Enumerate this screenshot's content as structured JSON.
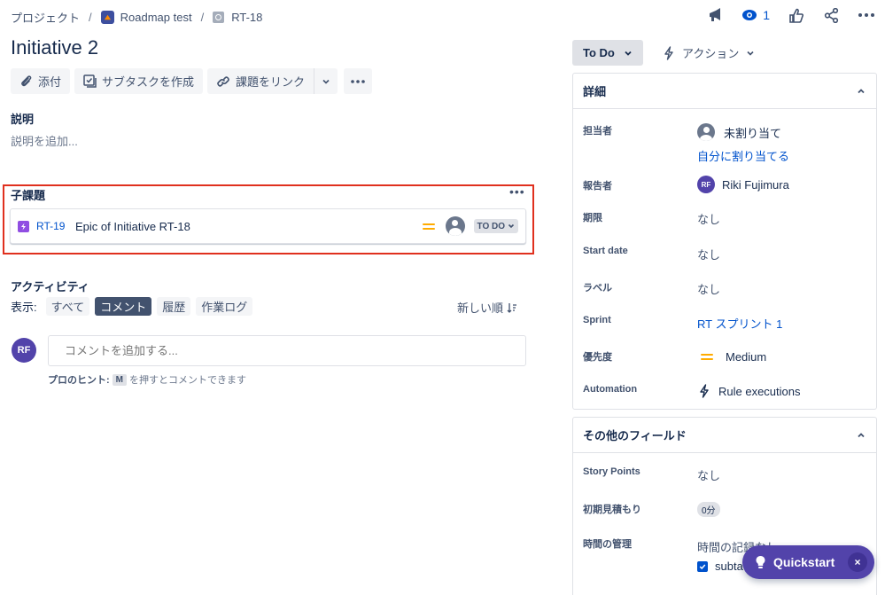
{
  "breadcrumb": {
    "project_root": "プロジェクト",
    "sep1": "/",
    "project": "Roadmap test",
    "sep2": "/",
    "issue_key": "RT-18"
  },
  "top_actions": {
    "watch_count": "1",
    "icons": [
      "megaphone-icon",
      "eye-icon",
      "thumbs-up-icon",
      "share-icon",
      "more-icon"
    ]
  },
  "issue": {
    "title": "Initiative 2"
  },
  "toolbar": {
    "attach": "添付",
    "create_subtask": "サブタスクを作成",
    "link_issue": "課題をリンク"
  },
  "description": {
    "label": "説明",
    "placeholder": "説明を追加..."
  },
  "child_issues": {
    "label": "子課題",
    "more": "•••",
    "items": [
      {
        "key": "RT-19",
        "summary": "Epic of Initiative RT-18",
        "status": "TO DO"
      }
    ]
  },
  "activity": {
    "title": "アクティビティ",
    "show_label": "表示:",
    "filters": [
      "すべて",
      "コメント",
      "履歴",
      "作業ログ"
    ],
    "active_filter": "コメント",
    "sort": "新しい順",
    "comment_avatar": "RF",
    "comment_placeholder": "コメントを追加する...",
    "pro_tip_bold": "プロのヒント:",
    "pro_tip_key": "M",
    "pro_tip_text": "を押すとコメントできます"
  },
  "status_button": "To Do",
  "action_button": "アクション",
  "details": {
    "header": "詳細",
    "assignee_label": "担当者",
    "assignee_value": "未割り当て",
    "assign_to_me": "自分に割り当てる",
    "reporter_label": "報告者",
    "reporter_avatar": "RF",
    "reporter_value": "Riki Fujimura",
    "due_label": "期限",
    "due_value": "なし",
    "start_label": "Start date",
    "start_value": "なし",
    "labels_label": "ラベル",
    "labels_value": "なし",
    "sprint_label": "Sprint",
    "sprint_value": "RT スプリント 1",
    "priority_label": "優先度",
    "priority_value": "Medium",
    "automation_label": "Automation",
    "automation_value": "Rule executions"
  },
  "other_fields": {
    "header": "その他のフィールド",
    "story_points_label": "Story Points",
    "story_points_value": "なし",
    "estimate_label": "初期見積もり",
    "estimate_value": "0分",
    "time_label": "時間の管理",
    "time_value": "時間の記録なし",
    "subtask_check": "subta"
  },
  "quickstart": {
    "label": "Quickstart",
    "close": "×"
  },
  "colors": {
    "accent": "#0052cc",
    "purple": "#5243aa",
    "highlight_border": "#e0301e",
    "priority_medium": "#ffab00"
  }
}
